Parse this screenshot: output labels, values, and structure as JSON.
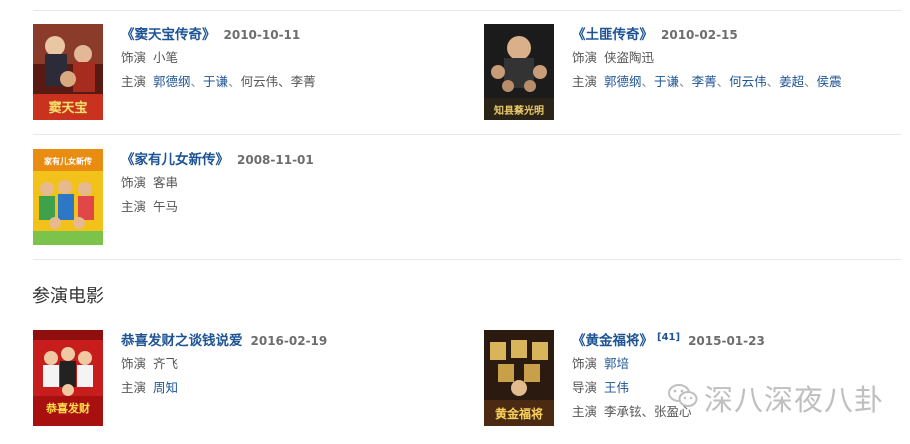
{
  "tv_items": [
    {
      "title": "《窦天宝传奇》",
      "date": "2010-10-11",
      "role_label": "饰演",
      "role": "小笔",
      "cast_label": "主演",
      "cast_links": [
        "郭德纲",
        "于谦"
      ],
      "cast_plain": "何云伟、李菁"
    },
    {
      "title": "《土匪传奇》",
      "date": "2010-02-15",
      "role_label": "饰演",
      "role": "侠盗陶迅",
      "cast_label": "主演",
      "cast_links": [
        "郭德纲",
        "于谦",
        "李菁",
        "何云伟",
        "姜超",
        "侯震"
      ],
      "cast_plain": ""
    },
    {
      "title": "《家有儿女新传》",
      "date": "2008-11-01",
      "role_label": "饰演",
      "role": "客串",
      "cast_label": "主演",
      "cast_links": [],
      "cast_plain": "午马"
    }
  ],
  "section_title": "参演电影",
  "movie_items": [
    {
      "title": "恭喜发财之谈钱说爱",
      "date": "2016-02-19",
      "role_label": "饰演",
      "role": "齐飞",
      "cast_label": "主演",
      "cast_links": [
        "周知"
      ],
      "cast_plain": ""
    },
    {
      "title": "《黄金福将》",
      "ref": "[41]",
      "date": "2015-01-23",
      "role_label": "饰演",
      "role_link": "郭培",
      "director_label": "导演",
      "director_link": "王伟",
      "cast_label": "主演",
      "cast_plain": "李承铉、张盈心"
    }
  ],
  "poster_captions": {
    "p1": "窦天宝",
    "p2": "知县蔡光明",
    "p3": "家有儿女新传",
    "p4": "恭喜发财",
    "p5": "黄金福将"
  },
  "watermark": {
    "text": "深八深夜八卦",
    "icon": "wechat-icon"
  },
  "colors": {
    "link": "#1e5494",
    "date": "#6d6d6d",
    "divider": "#e8e8e8"
  }
}
